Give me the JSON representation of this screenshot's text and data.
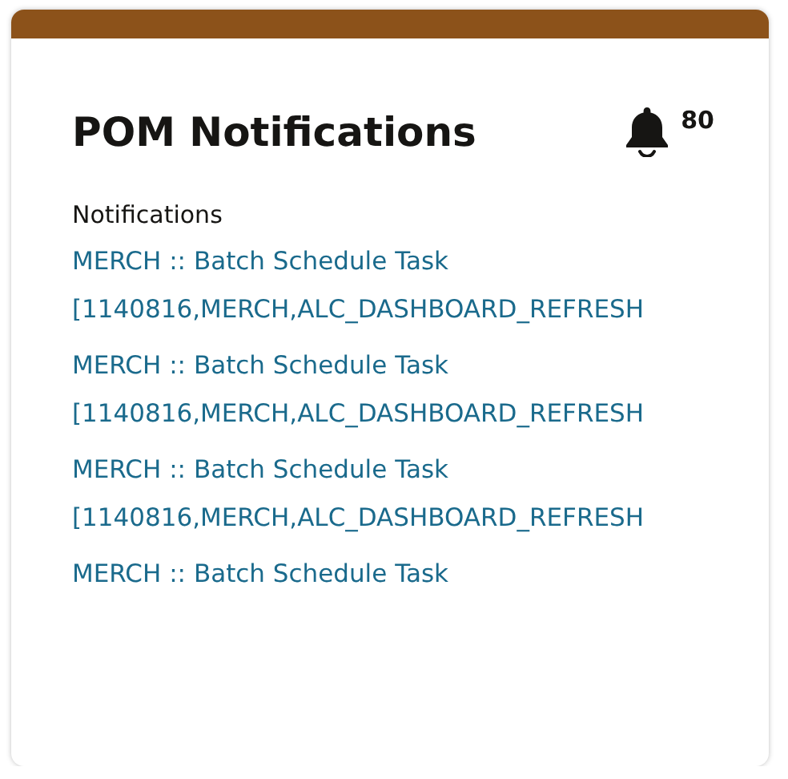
{
  "card": {
    "title": "POM Notifications",
    "badge_count": "80",
    "section_label": "Notifications",
    "notifications": [
      {
        "title": "MERCH :: Batch Schedule Task",
        "detail": "[1140816,MERCH,ALC_DASHBOARD_REFRESH"
      },
      {
        "title": "MERCH :: Batch Schedule Task",
        "detail": "[1140816,MERCH,ALC_DASHBOARD_REFRESH"
      },
      {
        "title": "MERCH :: Batch Schedule Task",
        "detail": "[1140816,MERCH,ALC_DASHBOARD_REFRESH"
      },
      {
        "title": "MERCH :: Batch Schedule Task"
      }
    ]
  }
}
